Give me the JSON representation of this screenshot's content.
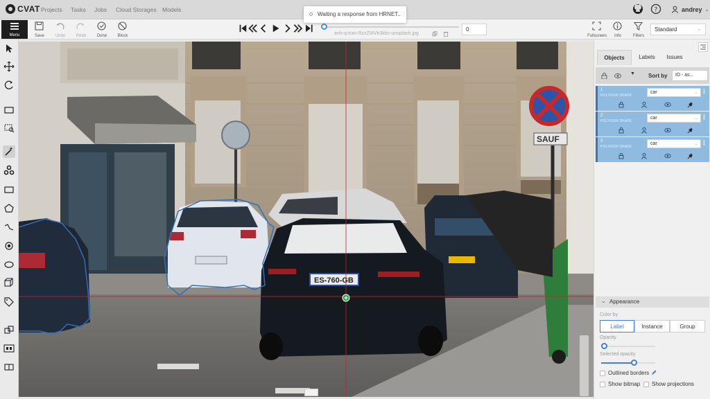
{
  "app": {
    "logo_text": "CVAT",
    "nav": [
      "Projects",
      "Tasks",
      "Jobs",
      "Cloud Storages",
      "Models"
    ],
    "notification": "Waiting a response from HRNET..",
    "user": "andrey"
  },
  "toolbar": {
    "menu_label": "Menu",
    "save_label": "Save",
    "undo_label": "Undo",
    "redo_label": "Redo",
    "done_label": "Done",
    "block_label": "Block",
    "frame_number": "0",
    "filename": "anh-q-tran-RzzZMVb3kbc-unsplash.jpg",
    "fullscreen_label": "Fullscreen",
    "info_label": "Info",
    "filters_label": "Filters",
    "workspace": "Standard"
  },
  "sidebar": {
    "tabs": [
      "Objects",
      "Labels",
      "Issues"
    ],
    "sort_by_label": "Sort by",
    "sort_value": "ID - as...",
    "objects": [
      {
        "id": "1",
        "type": "POLYGON SHAPE",
        "label": "car"
      },
      {
        "id": "2",
        "type": "POLYGON SHAPE",
        "label": "car"
      },
      {
        "id": "3",
        "type": "POLYGON SHAPE",
        "label": "car"
      }
    ],
    "appearance": {
      "title": "Appearance",
      "color_by_label": "Color by",
      "color_by_options": [
        "Label",
        "Instance",
        "Group"
      ],
      "color_by_selected": "Label",
      "opacity_label": "Opacity",
      "opacity_value": 0,
      "selected_opacity_label": "Selected opacity",
      "selected_opacity_value": 0.6,
      "outlined_borders_label": "Outlined borders",
      "show_bitmap_label": "Show bitmap",
      "show_projections_label": "Show projections"
    }
  },
  "colors": {
    "accent": "#3e7fd8",
    "object_item": "#8fbbe0",
    "annotation_stroke": "#2f6fbf",
    "crosshair": "#d42020"
  }
}
